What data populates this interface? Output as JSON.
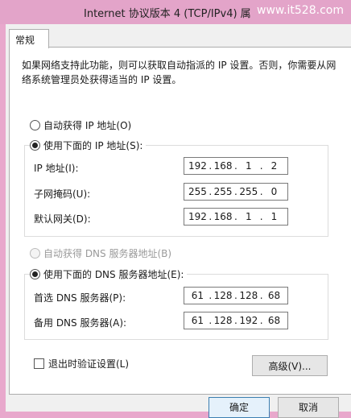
{
  "window": {
    "title": "Internet 协议版本 4 (TCP/IPv4) 属",
    "watermark": "www.it528.com"
  },
  "tabs": [
    {
      "label": "常规"
    }
  ],
  "description": "如果网络支持此功能，则可以获取自动指派的 IP 设置。否则，你需要从网络系统管理员处获得适当的 IP 设置。",
  "ip": {
    "auto_label": "自动获得 IP 地址(O)",
    "manual_label": "使用下面的 IP 地址(S):",
    "selected": "manual",
    "fields": [
      {
        "label": "IP 地址(I):",
        "octets": [
          "192",
          "168",
          "1",
          "2"
        ]
      },
      {
        "label": "子网掩码(U):",
        "octets": [
          "255",
          "255",
          "255",
          "0"
        ]
      },
      {
        "label": "默认网关(D):",
        "octets": [
          "192",
          "168",
          "1",
          "1"
        ]
      }
    ]
  },
  "dns": {
    "auto_label": "自动获得 DNS 服务器地址(B)",
    "auto_disabled": true,
    "manual_label": "使用下面的 DNS 服务器地址(E):",
    "selected": "manual",
    "fields": [
      {
        "label": "首选 DNS 服务器(P):",
        "octets": [
          "61",
          "128",
          "128",
          "68"
        ]
      },
      {
        "label": "备用 DNS 服务器(A):",
        "octets": [
          "61",
          "128",
          "192",
          "68"
        ]
      }
    ]
  },
  "validate_on_exit": {
    "label": "退出时验证设置(L)",
    "checked": false
  },
  "buttons": {
    "advanced": "高级(V)...",
    "ok": "确定",
    "cancel": "取消"
  }
}
